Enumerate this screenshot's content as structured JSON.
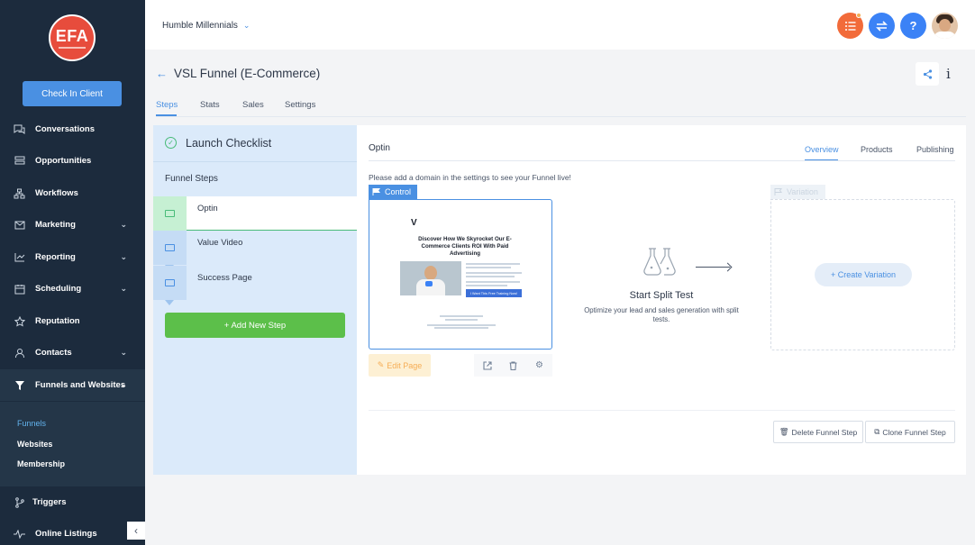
{
  "sidebar": {
    "logo_text": "EFA",
    "check_in_label": "Check In Client",
    "items": [
      {
        "label": "Conversations",
        "icon": "chat-icon",
        "chevron": false
      },
      {
        "label": "Opportunities",
        "icon": "layers-icon",
        "chevron": false
      },
      {
        "label": "Workflows",
        "icon": "workflow-icon",
        "chevron": false
      },
      {
        "label": "Marketing",
        "icon": "mail-icon",
        "chevron": true
      },
      {
        "label": "Reporting",
        "icon": "chart-icon",
        "chevron": true
      },
      {
        "label": "Scheduling",
        "icon": "calendar-icon",
        "chevron": true
      },
      {
        "label": "Reputation",
        "icon": "star-icon",
        "chevron": false
      },
      {
        "label": "Contacts",
        "icon": "user-icon",
        "chevron": true
      },
      {
        "label": "Funnels and Websites",
        "icon": "filter-icon",
        "chevron": true
      },
      {
        "label": "Triggers",
        "icon": "branch-icon",
        "chevron": false
      },
      {
        "label": "Online Listings",
        "icon": "pulse-icon",
        "chevron": false
      }
    ],
    "subitems": [
      "Funnels",
      "Websites",
      "Membership"
    ],
    "collapse_glyph": "‹"
  },
  "topbar": {
    "account_name": "Humble Millennials",
    "buttons": [
      {
        "icon": "list-icon",
        "color": "#f26b3a"
      },
      {
        "icon": "swap-icon",
        "color": "#3b82f6"
      },
      {
        "icon": "help-icon",
        "color": "#3b82f6",
        "glyph": "?"
      }
    ]
  },
  "page": {
    "title": "VSL Funnel (E-Commerce)",
    "info_glyph": "i",
    "tabs": [
      "Steps",
      "Stats",
      "Sales",
      "Settings"
    ]
  },
  "steps_panel": {
    "checklist_title": "Launch Checklist",
    "funnel_steps_title": "Funnel Steps",
    "steps": [
      "Optin",
      "Value Video",
      "Success Page"
    ],
    "add_step_label": "+ Add New Step"
  },
  "content": {
    "step_title": "Optin",
    "tabs": [
      "Overview",
      "Products",
      "Publishing"
    ],
    "domain_message": "Please add a domain in the settings to see your Funnel live!",
    "control_label": "Control",
    "variation_label": "Variation",
    "preview": {
      "logo": "V",
      "headline": "Discover How We Skyrocket Our E-Commerce Clients ROI With Paid Advertising",
      "button": "I Want This Free Training Now!"
    },
    "edit_page_label": "Edit Page",
    "split_test_title": "Start Split Test",
    "split_test_sub": "Optimize your lead and sales generation with split tests.",
    "create_variation_label": "+ Create Variation",
    "delete_step_label": "Delete Funnel Step",
    "clone_step_label": "Clone Funnel Step"
  },
  "colors": {
    "sidebar_bg": "#1c2b3d",
    "accent": "#4a90e2",
    "green": "#5cbf4a",
    "orange": "#f26b3a"
  }
}
